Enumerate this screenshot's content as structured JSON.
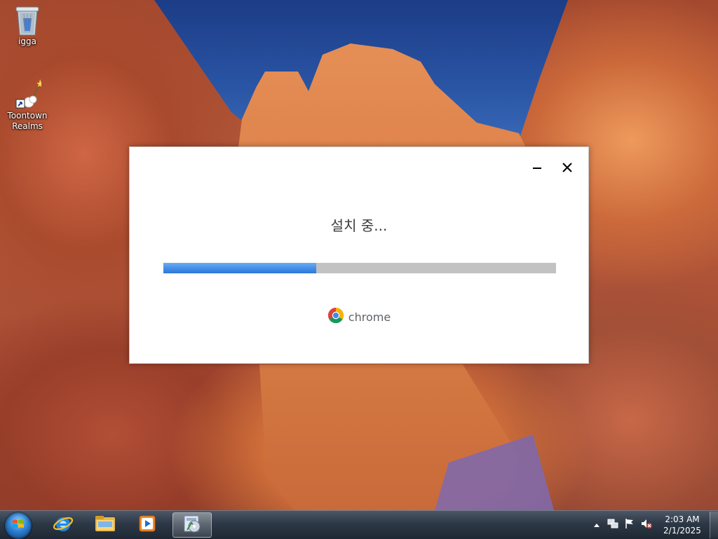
{
  "desktop": {
    "icons": [
      {
        "label": "igga",
        "icon": "recycle-bin-icon"
      },
      {
        "label": "Toontown Realms",
        "icon": "toontown-shortcut-icon"
      }
    ]
  },
  "installer": {
    "status": "설치 중...",
    "progress_fraction": 0.39,
    "brand_name": "chrome",
    "minimize_icon": "minimize-icon",
    "close_icon": "close-icon",
    "accent_color": "#3f8ae6",
    "track_color": "#c2c2c2"
  },
  "taskbar": {
    "pinned": [
      {
        "name": "internet-explorer-icon"
      },
      {
        "name": "windows-explorer-icon"
      },
      {
        "name": "media-player-icon"
      },
      {
        "name": "installer-task-icon",
        "active": true
      }
    ],
    "tray": {
      "icons": [
        "show-hidden-icons-chevron",
        "network-icon",
        "action-center-flag-icon",
        "volume-muted-icon"
      ]
    },
    "clock": {
      "time": "2:03 AM",
      "date": "2/1/2025"
    }
  }
}
